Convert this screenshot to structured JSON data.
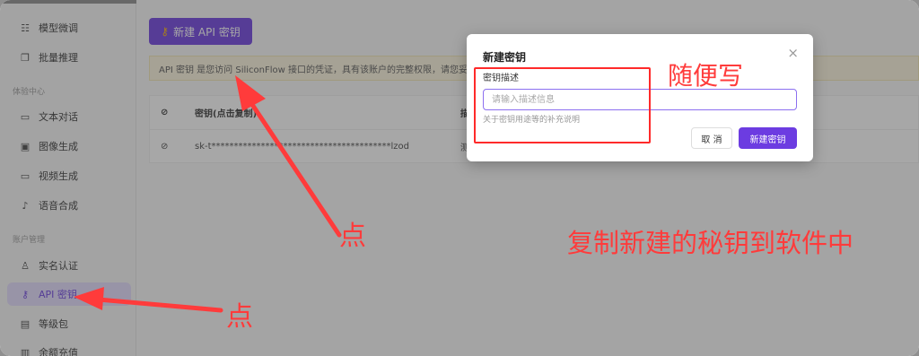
{
  "sidebar": {
    "items_top": [
      {
        "label": "模型微调",
        "icon": "sliders-icon",
        "glyph": "☷"
      },
      {
        "label": "批量推理",
        "icon": "layers-icon",
        "glyph": "❐"
      }
    ],
    "section_experience": "体验中心",
    "items_experience": [
      {
        "label": "文本对话",
        "icon": "chat-icon",
        "glyph": "▭"
      },
      {
        "label": "图像生成",
        "icon": "image-icon",
        "glyph": "▣"
      },
      {
        "label": "视频生成",
        "icon": "video-icon",
        "glyph": "▭"
      },
      {
        "label": "语音合成",
        "icon": "microphone-icon",
        "glyph": "♪"
      }
    ],
    "section_account": "账户管理",
    "items_account": [
      {
        "label": "实名认证",
        "icon": "user-check-icon",
        "glyph": "♙"
      },
      {
        "label": "API 密钥",
        "icon": "key-icon",
        "glyph": "⚷",
        "active": true
      },
      {
        "label": "等级包",
        "icon": "package-icon",
        "glyph": "▤"
      },
      {
        "label": "余额充值",
        "icon": "wallet-icon",
        "glyph": "▥"
      }
    ]
  },
  "main": {
    "new_key_button": "新建 API 密钥",
    "notice": "API 密钥 是您访问 SiliconFlow 接口的凭证，具有该账户的完整权限，请您妥",
    "table": {
      "headers": [
        "密钥(点击复制)",
        "描"
      ],
      "rows": [
        {
          "key": "sk-t****************************************lzod",
          "desc": "测"
        }
      ]
    }
  },
  "modal": {
    "title": "新建密钥",
    "close": "×",
    "field_label": "密钥描述",
    "field_placeholder": "请输入描述信息",
    "field_value": "",
    "field_help": "关于密钥用途等的补充说明",
    "cancel": "取 消",
    "create": "新建密钥"
  },
  "annotations": {
    "write_anything": "随便写",
    "click_top": "点",
    "click_bottom": "点",
    "copy_hint": "复制新建的秘钥到软件中",
    "color": "#ff3b3b"
  },
  "colors": {
    "accent": "#6c3ce1",
    "active_bg": "#e4dcff",
    "notice_bg": "#fdf6df"
  }
}
